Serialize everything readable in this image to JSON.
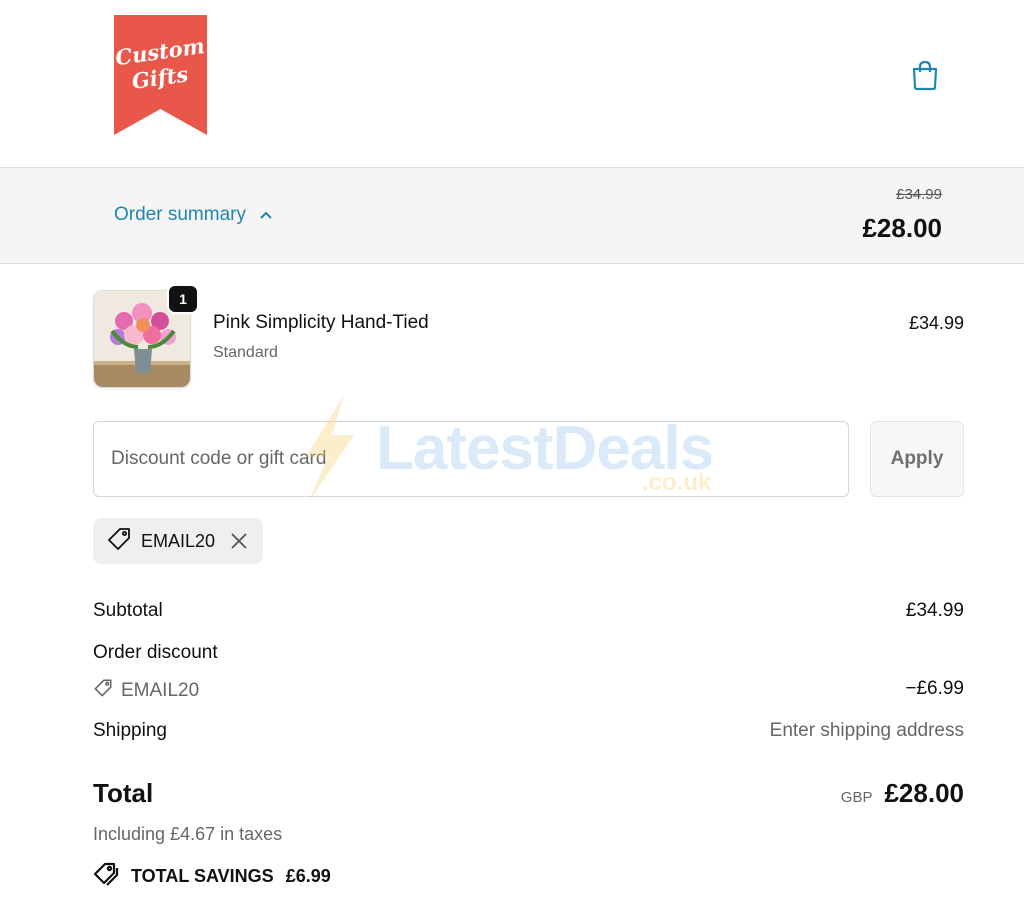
{
  "brand": {
    "logo_line1": "Custom",
    "logo_line2": "Gifts",
    "logo_color": "#e8574a"
  },
  "header": {
    "cart_icon": "shopping-bag-icon"
  },
  "order_summary": {
    "toggle_label": "Order summary",
    "original_price": "£34.99",
    "total": "£28.00",
    "accent_color": "#1f86b1"
  },
  "line_item": {
    "quantity": "1",
    "name": "Pink Simplicity Hand-Tied",
    "variant": "Standard",
    "price": "£34.99",
    "image_icon": "flower-bouquet-image"
  },
  "discount": {
    "placeholder": "Discount code or gift card",
    "apply_label": "Apply",
    "applied_code": "EMAIL20"
  },
  "watermark": {
    "main": "LatestDeals",
    "sub": ".co.uk"
  },
  "totals": {
    "subtotal_label": "Subtotal",
    "subtotal_value": "£34.99",
    "discount_label": "Order discount",
    "discount_code": "EMAIL20",
    "discount_value": "−£6.99",
    "shipping_label": "Shipping",
    "shipping_value": "Enter shipping address",
    "total_label": "Total",
    "currency": "GBP",
    "total_value": "£28.00",
    "taxes_note": "Including £4.67 in taxes",
    "savings_label": "TOTAL SAVINGS",
    "savings_value": "£6.99"
  }
}
